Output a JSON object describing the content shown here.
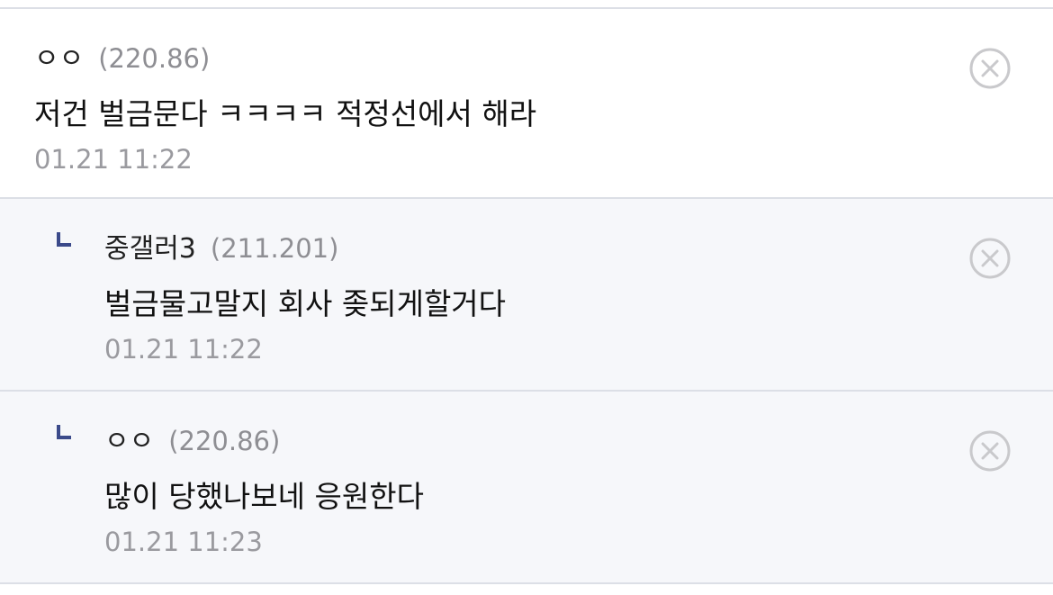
{
  "comments": [
    {
      "author": "ㅇㅇ",
      "ip": "(220.86)",
      "text": "저건 벌금문다 ㅋㅋㅋㅋ 적정선에서 해라",
      "time": "01.21 11:22",
      "is_reply": false
    },
    {
      "author": "중갤러3",
      "ip": "(211.201)",
      "text": "벌금물고말지 회사 좆되게할거다",
      "time": "01.21 11:22",
      "is_reply": true
    },
    {
      "author": "ㅇㅇ",
      "ip": "(220.86)",
      "text": "많이 당했나보네 응원한다",
      "time": "01.21 11:23",
      "is_reply": true
    }
  ],
  "icons": {
    "reply": "reply-arrow-icon",
    "delete": "close-circle-icon"
  },
  "colors": {
    "reply_marker": "#3b4a8a",
    "reply_background": "#f6f7fa",
    "divider": "#dcdfe6",
    "meta_text": "#8e8e93"
  }
}
